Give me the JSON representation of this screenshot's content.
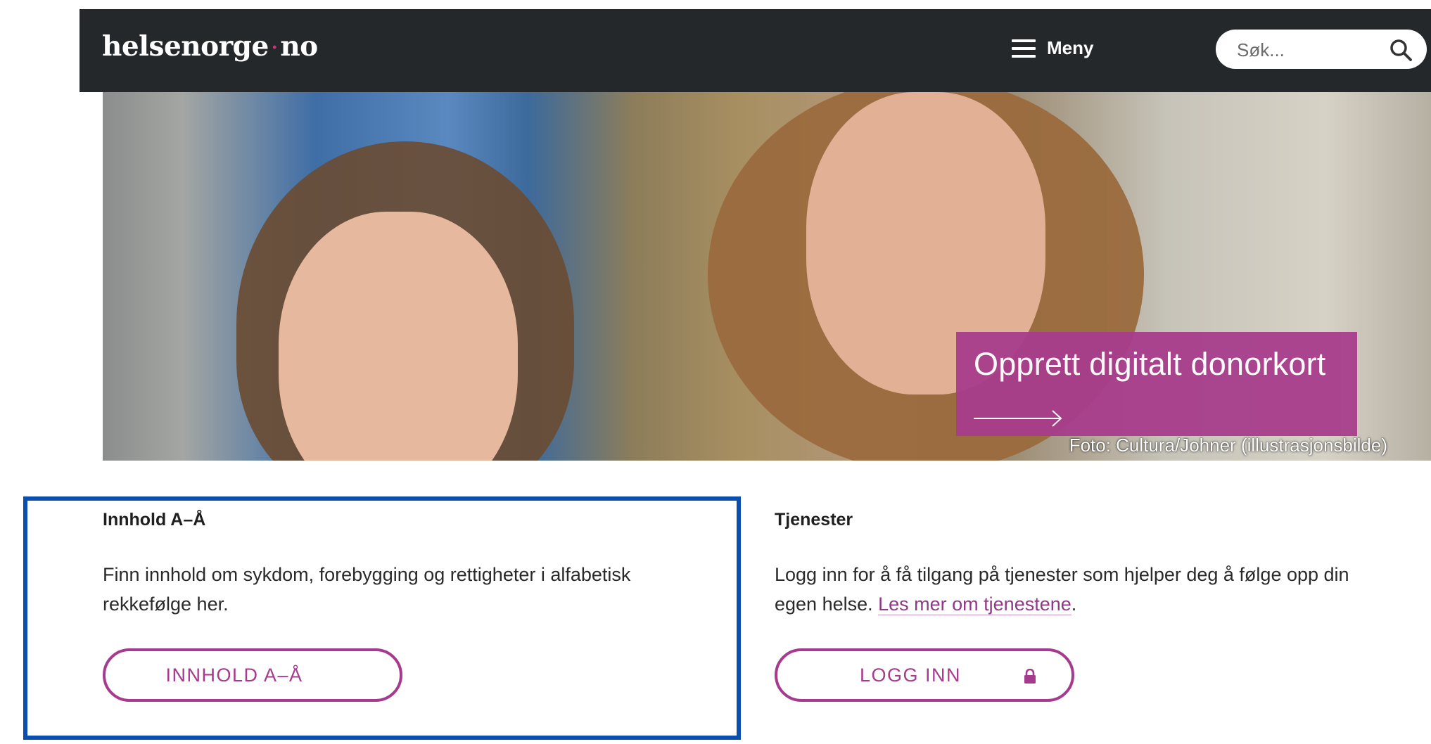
{
  "header": {
    "logo_left": "helsenorge",
    "logo_dot": "·",
    "logo_right": "no",
    "menu_label": "Meny",
    "search_placeholder": "Søk...",
    "background_color": "#25282a"
  },
  "hero": {
    "promo_title": "Opprett digitalt donorkort",
    "promo_color": "#a83d8c",
    "caption": "Foto: Cultura/Johner (illustrasjonsbilde)"
  },
  "sections": [
    {
      "title": "Innhold A–Å",
      "text": "Finn innhold om sykdom, forebygging og rettigheter i alfabetisk rekkefølge her.",
      "button_label": "INNHOLD A–Å"
    },
    {
      "title": "Tjenester",
      "text_before": "Logg inn for å få tilgang på tjenester som hjelper deg å følge opp din egen helse. ",
      "link_label": "Les mer om tjenestene",
      "text_after": ".",
      "button_label": "LOGG INN"
    }
  ],
  "accent_color": "#a53a8e",
  "highlight_color": "#0a4fb0"
}
